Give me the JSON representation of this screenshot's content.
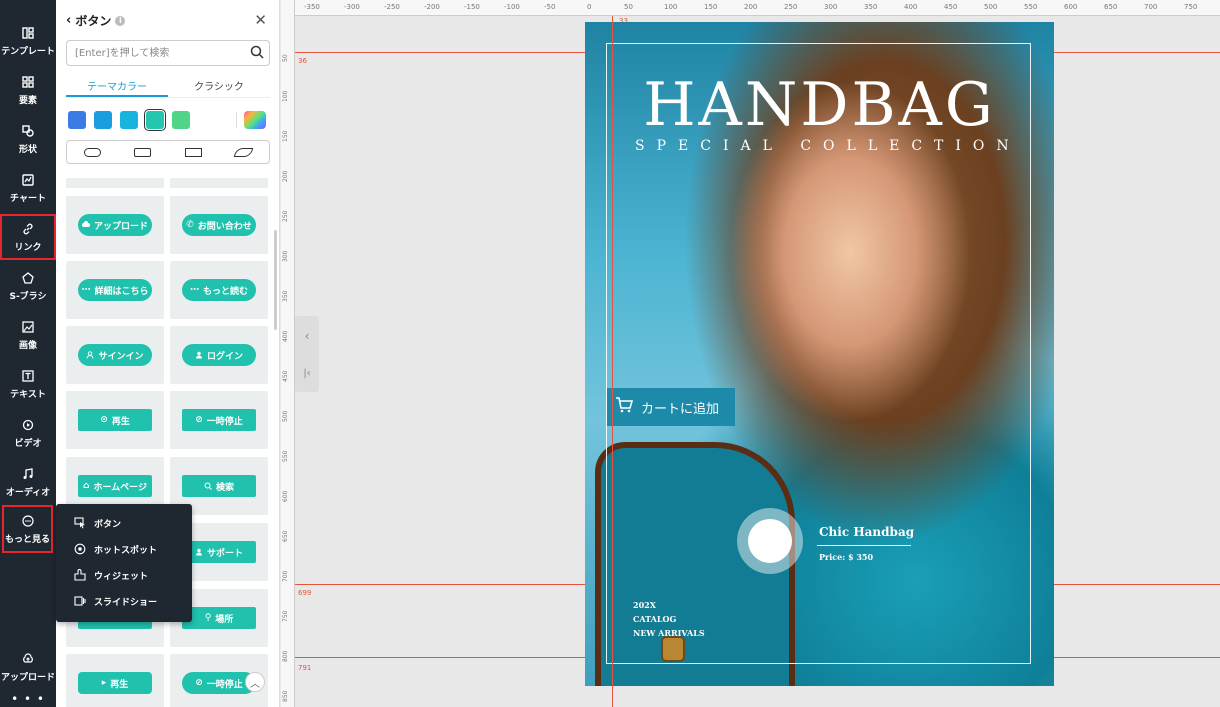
{
  "sidebar": {
    "items": [
      {
        "label": "テンプレート",
        "icon": "template-icon"
      },
      {
        "label": "要素",
        "icon": "elements-icon"
      },
      {
        "label": "形状",
        "icon": "shapes-icon"
      },
      {
        "label": "チャート",
        "icon": "chart-icon"
      },
      {
        "label": "リンク",
        "icon": "link-icon"
      },
      {
        "label": "S-ブラシ",
        "icon": "brush-icon"
      },
      {
        "label": "画像",
        "icon": "image-icon"
      },
      {
        "label": "テキスト",
        "icon": "text-icon"
      },
      {
        "label": "ビデオ",
        "icon": "video-icon"
      },
      {
        "label": "オーディオ",
        "icon": "audio-icon"
      },
      {
        "label": "もっと見る",
        "icon": "more-icon"
      },
      {
        "label": "アップロード",
        "icon": "upload-icon"
      }
    ],
    "highlight_color": "#e3262f"
  },
  "panel": {
    "title": "ボタン",
    "search_placeholder": "[Enter]を押して検索",
    "tabs": [
      {
        "label": "テーマカラー",
        "active": true
      },
      {
        "label": "クラシック",
        "active": false
      }
    ],
    "swatches": [
      "#3a7be6",
      "#1b9ee0",
      "#17b4e0",
      "#25c6b0",
      "#4fd48a"
    ],
    "selected_swatch": "#25c6b0",
    "button_color": "#20c1ad",
    "buttons": [
      {
        "label": "アップロード",
        "shape": "pill",
        "icon": "cloud-icon"
      },
      {
        "label": "お問い合わせ",
        "shape": "pill",
        "icon": "phone-icon"
      },
      {
        "label": "詳細はこちら",
        "shape": "pill",
        "icon": "dots-icon"
      },
      {
        "label": "もっと読む",
        "shape": "pill",
        "icon": "dots-icon"
      },
      {
        "label": "サインイン",
        "shape": "pill",
        "icon": "user-icon"
      },
      {
        "label": "ログイン",
        "shape": "pill",
        "icon": "user-icon"
      },
      {
        "label": "再生",
        "shape": "rect",
        "icon": "play-circle-icon"
      },
      {
        "label": "一時停止",
        "shape": "rect",
        "icon": "pause-circle-icon"
      },
      {
        "label": "ホームページ",
        "shape": "rect",
        "icon": "home-icon"
      },
      {
        "label": "検索",
        "shape": "rect",
        "icon": "search-icon"
      },
      {
        "label": "",
        "shape": "rect",
        "icon": ""
      },
      {
        "label": "サポート",
        "shape": "rect",
        "icon": "user-icon"
      },
      {
        "label": "",
        "shape": "rect",
        "icon": ""
      },
      {
        "label": "場所",
        "shape": "rect",
        "icon": "pin-icon"
      },
      {
        "label": "再生",
        "shape": "pill",
        "icon": "play-icon"
      },
      {
        "label": "一時停止",
        "shape": "pill",
        "icon": "pause-circle-icon"
      }
    ]
  },
  "popup": {
    "items": [
      {
        "label": "ボタン",
        "icon": "cursor-button-icon"
      },
      {
        "label": "ホットスポット",
        "icon": "hotspot-icon"
      },
      {
        "label": "ウィジェット",
        "icon": "widget-icon"
      },
      {
        "label": "スライドショー",
        "icon": "slideshow-icon"
      }
    ]
  },
  "ruler": {
    "top_ticks": [
      "-350",
      "-300",
      "-250",
      "-200",
      "-150",
      "-100",
      "-50",
      "0",
      "50",
      "100",
      "150",
      "200",
      "250",
      "300",
      "350",
      "400",
      "450",
      "500",
      "550",
      "600",
      "650",
      "700",
      "750"
    ],
    "left_ticks": [
      "50",
      "100",
      "150",
      "200",
      "250",
      "300",
      "350",
      "400",
      "450",
      "500",
      "550",
      "600",
      "650",
      "700",
      "750",
      "800",
      "850"
    ],
    "guide_labels": {
      "top": "36",
      "v": "33",
      "h1": "699",
      "h2": "791"
    },
    "guide_color": "#e3553c"
  },
  "poster": {
    "title": "HANDBAG",
    "subtitle": "SPECIAL COLLECTION",
    "cart_button": "カートに追加",
    "product_name": "Chic Handbag",
    "price": "Price: $ 350",
    "catalog_lines": [
      "202X",
      "CATALOG",
      "NEW ARRIVALS"
    ],
    "cart_color": "#1c8aa8"
  }
}
